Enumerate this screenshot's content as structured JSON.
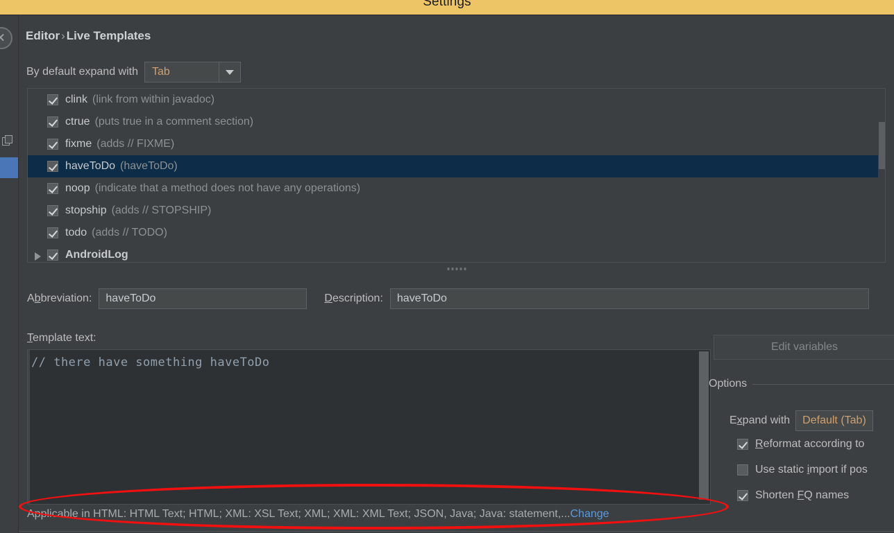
{
  "window": {
    "title": "Settings"
  },
  "left_rail": {
    "close_icon": "close-icon",
    "copy_icon": "copy-icon"
  },
  "breadcrumb": {
    "root": "Editor",
    "separator": "›",
    "current": "Live Templates"
  },
  "expand_with": {
    "label": "By default expand with",
    "value": "Tab"
  },
  "template_list": {
    "rows": [
      {
        "checked": true,
        "name": "clink",
        "desc": "(link from within javadoc)",
        "selected": false,
        "group": false
      },
      {
        "checked": true,
        "name": "ctrue",
        "desc": "(puts true in a comment section)",
        "selected": false,
        "group": false
      },
      {
        "checked": true,
        "name": "fixme",
        "desc": "(adds // FIXME)",
        "selected": false,
        "group": false
      },
      {
        "checked": true,
        "name": "haveToDo",
        "desc": "(haveToDo)",
        "selected": true,
        "group": false
      },
      {
        "checked": true,
        "name": "noop",
        "desc": "(indicate that a method does not have any operations)",
        "selected": false,
        "group": false
      },
      {
        "checked": true,
        "name": "stopship",
        "desc": "(adds // STOPSHIP)",
        "selected": false,
        "group": false
      },
      {
        "checked": true,
        "name": "todo",
        "desc": "(adds // TODO)",
        "selected": false,
        "group": false
      },
      {
        "checked": true,
        "name": "AndroidLog",
        "desc": "",
        "selected": false,
        "group": true
      }
    ]
  },
  "editor": {
    "abbreviation_label": "Abbreviation:",
    "abbreviation_value": "haveToDo",
    "description_label": "Description:",
    "description_value": "haveToDo",
    "template_text_label": "Template text:",
    "template_text_value": "// there have something haveToDo"
  },
  "options": {
    "edit_variables_label": "Edit variables",
    "legend": "Options",
    "expand_with_label": "Expand with",
    "expand_with_value": "Default (Tab)",
    "checkboxes": [
      {
        "label": "Reformat according to",
        "checked": true
      },
      {
        "label": "Use static import if pos",
        "checked": false
      },
      {
        "label": "Shorten FQ names",
        "checked": true
      }
    ]
  },
  "applicable": {
    "text": "Applicable in HTML: HTML Text; HTML; XML: XSL Text; XML; XML: XML Text; JSON, Java; Java: statement,...",
    "change_link": "Change"
  },
  "colors": {
    "titlebar": "#edc567",
    "background": "#3c3f41",
    "selection": "#0d2c47",
    "accent_link": "#5a9ae0",
    "annotation": "#f01010",
    "combo_value": "#d0a070"
  }
}
